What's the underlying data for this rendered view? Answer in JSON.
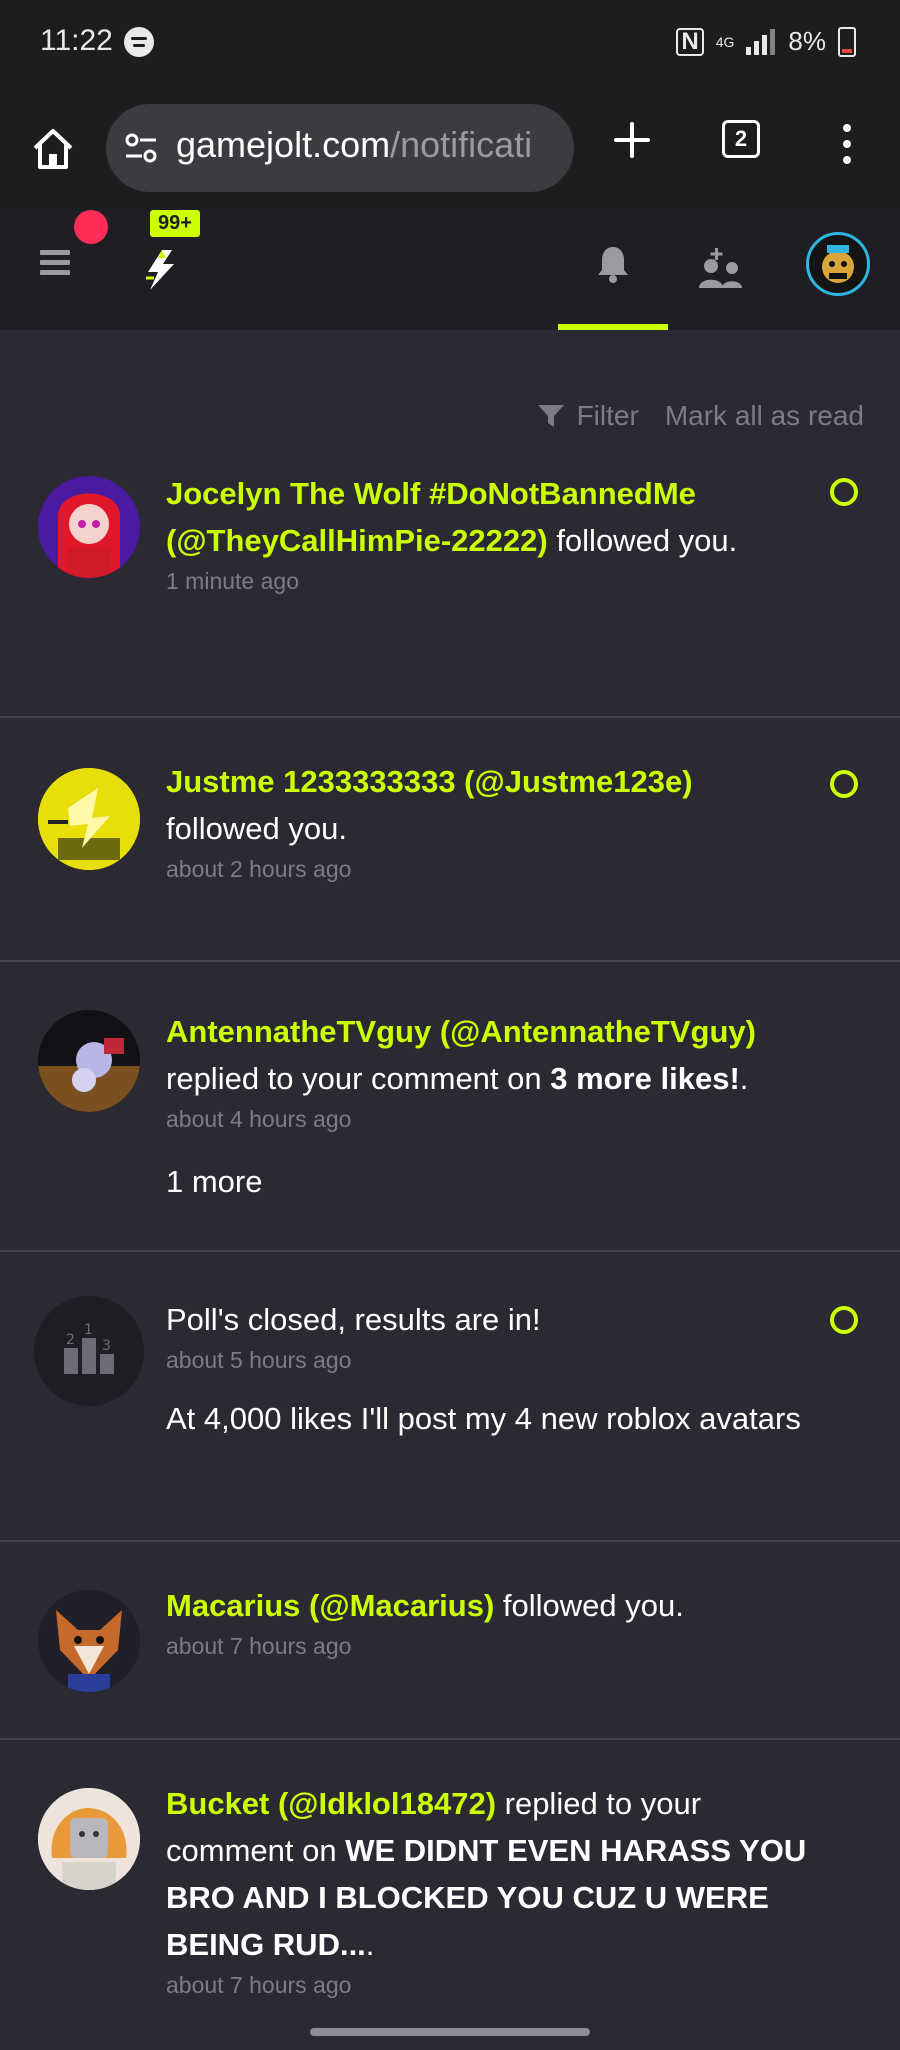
{
  "status_bar": {
    "time": "11:22",
    "network": "4G",
    "battery": "8%"
  },
  "browser": {
    "url_host": "gamejolt.com",
    "url_path": "/notificati",
    "tab_count": "2"
  },
  "header": {
    "badge": "99+",
    "accent_color": "#ccff00"
  },
  "toolbar": {
    "filter_label": "Filter",
    "mark_all_label": "Mark all as read"
  },
  "notifications": [
    {
      "user": "Jocelyn The Wolf #DoNotBannedMe (@TheyCallHimPie-22222)",
      "action": " followed you.",
      "time": "1 minute ago",
      "unread": true
    },
    {
      "user": "Justme 1233333333 (@Justme123e)",
      "action": " followed you.",
      "time": "about 2 hours ago",
      "unread": true
    },
    {
      "user": "AntennatheTVguy (@AntennatheTVguy)",
      "action": " replied to your comment on ",
      "target": "3 more likes!",
      "suffix": ".",
      "time": "about 4 hours ago",
      "extra": "1 more",
      "unread": false
    },
    {
      "title": "Poll's closed, results are in!",
      "time": "about 5 hours ago",
      "extra": "At 4,000 likes I'll post my 4 new roblox avatars",
      "unread": true
    },
    {
      "user": "Macarius (@Macarius)",
      "action": " followed you.",
      "time": "about 7 hours ago",
      "unread": false
    },
    {
      "user": "Bucket (@Idklol18472)",
      "action": " replied to your comment on ",
      "target": "WE DIDNT EVEN HARASS YOU BRO AND I BLOCKED YOU CUZ U WERE BEING RUD...",
      "suffix": ".",
      "time": "about 7 hours ago",
      "unread": false
    }
  ]
}
